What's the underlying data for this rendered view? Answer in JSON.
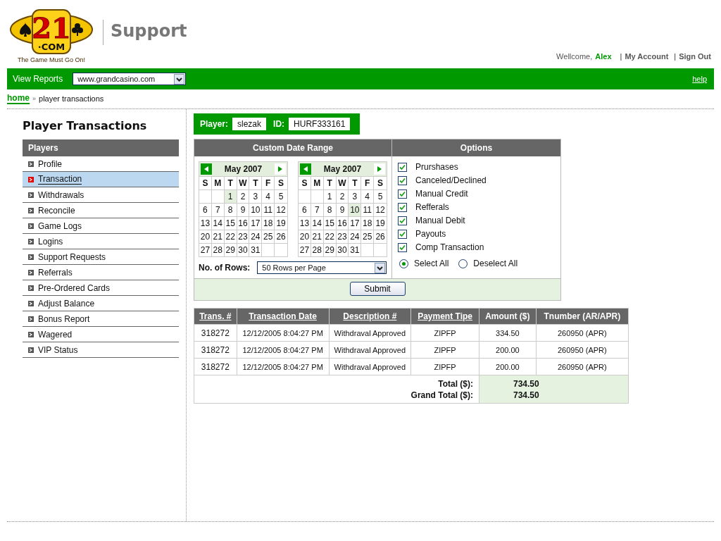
{
  "logo": {
    "number": "21",
    "domain": "·COM",
    "tagline": "The Game Must Go On!"
  },
  "header": {
    "title": "Support",
    "welcome": "Wellcome,",
    "user": "Alex",
    "links": [
      {
        "separator": "|",
        "label": "My Account"
      },
      {
        "separator": "|",
        "label": "Sign Out"
      }
    ]
  },
  "report_bar": {
    "label": "View Reports",
    "site": "www.grandcasino.com",
    "help": "help"
  },
  "breadcrumb": {
    "home": "home",
    "separator": "»",
    "current": "player transactions"
  },
  "page_title": "Player Transactions",
  "sidebar": {
    "title": "Players",
    "items": [
      {
        "label": "Profile",
        "selected": false
      },
      {
        "label": "Transaction",
        "selected": true
      },
      {
        "label": "Withdrawals",
        "selected": false
      },
      {
        "label": "Reconcile",
        "selected": false
      },
      {
        "label": "Game Logs",
        "selected": false
      },
      {
        "label": "Logins",
        "selected": false
      },
      {
        "label": "Support Requests",
        "selected": false
      },
      {
        "label": "Referrals",
        "selected": false
      },
      {
        "label": "Pre-Ordered Cards",
        "selected": false
      },
      {
        "label": "Adjust Balance",
        "selected": false
      },
      {
        "label": "Bonus Report",
        "selected": false
      },
      {
        "label": "Wagered",
        "selected": false
      },
      {
        "label": "VIP Status",
        "selected": false
      }
    ]
  },
  "player": {
    "label": "Player:",
    "name": "slezak",
    "id_label": "ID:",
    "id": "HURF333161"
  },
  "date_range": {
    "title": "Custom Date Range",
    "rows_label": "No. of Rows:",
    "rows_value": "50 Rows per Page",
    "calendars": [
      {
        "month": "May 2007",
        "weekdays": [
          "S",
          "M",
          "T",
          "W",
          "T",
          "F",
          "S"
        ],
        "weeks": [
          [
            {
              "kind": "blank"
            },
            {
              "kind": "blank"
            },
            {
              "kind": "day",
              "day": "1",
              "selected": true
            },
            {
              "kind": "day",
              "day": "2",
              "selected": false
            },
            {
              "kind": "day",
              "day": "3",
              "selected": false
            },
            {
              "kind": "day",
              "day": "4",
              "selected": false
            },
            {
              "kind": "day",
              "day": "5",
              "selected": false
            }
          ],
          [
            {
              "kind": "day",
              "day": "6",
              "selected": false
            },
            {
              "kind": "day",
              "day": "7",
              "selected": false
            },
            {
              "kind": "day",
              "day": "8",
              "selected": false
            },
            {
              "kind": "day",
              "day": "9",
              "selected": false
            },
            {
              "kind": "day",
              "day": "10",
              "selected": false
            },
            {
              "kind": "day",
              "day": "11",
              "selected": false
            },
            {
              "kind": "day",
              "day": "12",
              "selected": false
            }
          ],
          [
            {
              "kind": "day",
              "day": "13",
              "selected": false
            },
            {
              "kind": "day",
              "day": "14",
              "selected": false
            },
            {
              "kind": "day",
              "day": "15",
              "selected": false
            },
            {
              "kind": "day",
              "day": "16",
              "selected": false
            },
            {
              "kind": "day",
              "day": "17",
              "selected": false
            },
            {
              "kind": "day",
              "day": "18",
              "selected": false
            },
            {
              "kind": "day",
              "day": "19",
              "selected": false
            }
          ],
          [
            {
              "kind": "day",
              "day": "20",
              "selected": false
            },
            {
              "kind": "day",
              "day": "21",
              "selected": false
            },
            {
              "kind": "day",
              "day": "22",
              "selected": false
            },
            {
              "kind": "day",
              "day": "23",
              "selected": false
            },
            {
              "kind": "day",
              "day": "24",
              "selected": false
            },
            {
              "kind": "day",
              "day": "25",
              "selected": false
            },
            {
              "kind": "day",
              "day": "26",
              "selected": false
            }
          ],
          [
            {
              "kind": "day",
              "day": "27",
              "selected": false
            },
            {
              "kind": "day",
              "day": "28",
              "selected": false
            },
            {
              "kind": "day",
              "day": "29",
              "selected": false
            },
            {
              "kind": "day",
              "day": "30",
              "selected": false
            },
            {
              "kind": "day",
              "day": "31",
              "selected": false
            },
            {
              "kind": "blank"
            },
            {
              "kind": "blank"
            }
          ]
        ]
      },
      {
        "month": "May 2007",
        "weekdays": [
          "S",
          "M",
          "T",
          "W",
          "T",
          "F",
          "S"
        ],
        "weeks": [
          [
            {
              "kind": "blank"
            },
            {
              "kind": "blank"
            },
            {
              "kind": "day",
              "day": "1",
              "selected": false
            },
            {
              "kind": "day",
              "day": "2",
              "selected": false
            },
            {
              "kind": "day",
              "day": "3",
              "selected": false
            },
            {
              "kind": "day",
              "day": "4",
              "selected": false
            },
            {
              "kind": "day",
              "day": "5",
              "selected": false
            }
          ],
          [
            {
              "kind": "day",
              "day": "6",
              "selected": false
            },
            {
              "kind": "day",
              "day": "7",
              "selected": false
            },
            {
              "kind": "day",
              "day": "8",
              "selected": false
            },
            {
              "kind": "day",
              "day": "9",
              "selected": false
            },
            {
              "kind": "day",
              "day": "10",
              "selected": true
            },
            {
              "kind": "day",
              "day": "11",
              "selected": false
            },
            {
              "kind": "day",
              "day": "12",
              "selected": false
            }
          ],
          [
            {
              "kind": "day",
              "day": "13",
              "selected": false
            },
            {
              "kind": "day",
              "day": "14",
              "selected": false
            },
            {
              "kind": "day",
              "day": "15",
              "selected": false
            },
            {
              "kind": "day",
              "day": "16",
              "selected": false
            },
            {
              "kind": "day",
              "day": "17",
              "selected": false
            },
            {
              "kind": "day",
              "day": "18",
              "selected": false
            },
            {
              "kind": "day",
              "day": "19",
              "selected": false
            }
          ],
          [
            {
              "kind": "day",
              "day": "20",
              "selected": false
            },
            {
              "kind": "day",
              "day": "21",
              "selected": false
            },
            {
              "kind": "day",
              "day": "22",
              "selected": false
            },
            {
              "kind": "day",
              "day": "23",
              "selected": false
            },
            {
              "kind": "day",
              "day": "24",
              "selected": false
            },
            {
              "kind": "day",
              "day": "25",
              "selected": false
            },
            {
              "kind": "day",
              "day": "26",
              "selected": false
            }
          ],
          [
            {
              "kind": "day",
              "day": "27",
              "selected": false
            },
            {
              "kind": "day",
              "day": "28",
              "selected": false
            },
            {
              "kind": "day",
              "day": "29",
              "selected": false
            },
            {
              "kind": "day",
              "day": "30",
              "selected": false
            },
            {
              "kind": "day",
              "day": "31",
              "selected": false
            },
            {
              "kind": "blank"
            },
            {
              "kind": "blank"
            }
          ]
        ]
      }
    ]
  },
  "options": {
    "title": "Options",
    "items": [
      {
        "label": "Prurshases",
        "checked": true
      },
      {
        "label": "Canceled/Declined",
        "checked": true
      },
      {
        "label": "Manual Credit",
        "checked": true
      },
      {
        "label": "Refferals",
        "checked": true
      },
      {
        "label": "Manual Debit",
        "checked": true
      },
      {
        "label": "Payouts",
        "checked": true
      },
      {
        "label": "Comp Transaction",
        "checked": true
      }
    ],
    "radios": [
      {
        "label": "Select All",
        "selected": true
      },
      {
        "label": "Deselect All",
        "selected": false
      }
    ]
  },
  "submit": "Submit",
  "table": {
    "columns": [
      {
        "label": "Trans. #",
        "sortable": true
      },
      {
        "label": "Transaction Date",
        "sortable": true
      },
      {
        "label": "Description #",
        "sortable": true
      },
      {
        "label": "Payment Tipe",
        "sortable": true
      },
      {
        "label": "Amount ($)",
        "sortable": false
      },
      {
        "label": "Tnumber (AR/APR)",
        "sortable": false
      }
    ],
    "rows": [
      [
        "318272",
        "12/12/2005 8:04:27 PM",
        "Withdraval Approved",
        "ZIPFP",
        "334.50",
        "260950 (APR)"
      ],
      [
        "318272",
        "12/12/2005 8:04:27 PM",
        "Withdraval Approved",
        "ZIPFP",
        "200.00",
        "260950 (APR)"
      ],
      [
        "318272",
        "12/12/2005 8:04:27 PM",
        "Withdraval Approved",
        "ZIPFP",
        "200.00",
        "260950 (APR)"
      ]
    ],
    "totals": [
      {
        "label": "Total ($):",
        "value": "734.50"
      },
      {
        "label": "Grand Total ($):",
        "value": "734.50"
      }
    ]
  }
}
